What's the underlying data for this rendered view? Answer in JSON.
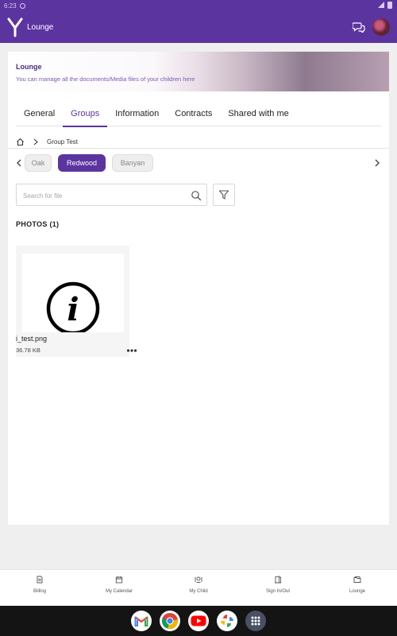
{
  "status_bar": {
    "time": "6:23"
  },
  "app_bar": {
    "title": "Lounge"
  },
  "hero": {
    "title": "Lounge",
    "subtitle": "You can manage all the documents/Media files of your children here"
  },
  "tabs": [
    {
      "label": "General",
      "active": false
    },
    {
      "label": "Groups",
      "active": true
    },
    {
      "label": "Information",
      "active": false
    },
    {
      "label": "Contracts",
      "active": false
    },
    {
      "label": "Shared with me",
      "active": false
    }
  ],
  "breadcrumb": {
    "current": "Group Test"
  },
  "groups": [
    {
      "label": "Oak",
      "active": false
    },
    {
      "label": "Redwood",
      "active": true
    },
    {
      "label": "Banyan",
      "active": false
    }
  ],
  "search": {
    "placeholder": "Search for file"
  },
  "photos_section": {
    "label": "PHOTOS (1)"
  },
  "files": [
    {
      "name": "i_test.png",
      "size": "36.78 KB",
      "thumbnail_glyph": "i"
    }
  ],
  "bottom_nav": [
    {
      "label": "Billing",
      "icon": "receipt-icon"
    },
    {
      "label": "My Calendar",
      "icon": "calendar-icon"
    },
    {
      "label": "My Child",
      "icon": "child-icon"
    },
    {
      "label": "Sign In/Out",
      "icon": "door-icon"
    },
    {
      "label": "Lounge",
      "icon": "folder-icon"
    }
  ],
  "dock": [
    "gmail-icon",
    "chrome-icon",
    "youtube-icon",
    "photos-icon",
    "app-drawer-icon"
  ],
  "colors": {
    "primary": "#5b34a0",
    "primary_text": "#4a2a86",
    "background": "#efefef"
  }
}
